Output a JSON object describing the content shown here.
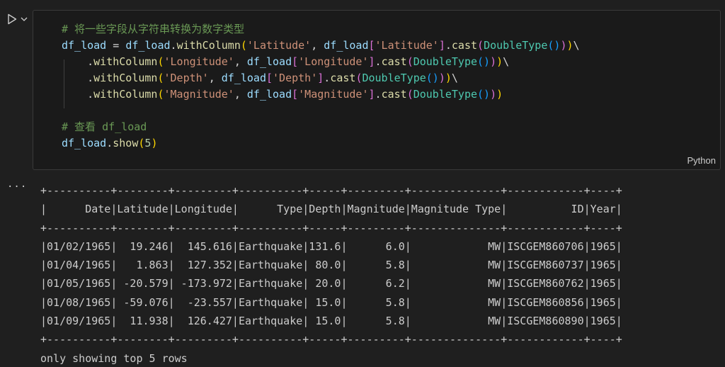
{
  "cell": {
    "language": "Python",
    "code_lines": [
      [
        {
          "t": "# 将一些字段从字符串转换为数字类型",
          "c": "c-comment"
        }
      ],
      [
        {
          "t": "df_load",
          "c": "c-var"
        },
        {
          "t": " = ",
          "c": "c-op"
        },
        {
          "t": "df_load",
          "c": "c-var"
        },
        {
          "t": ".",
          "c": "c-op"
        },
        {
          "t": "withColumn",
          "c": "c-fn"
        },
        {
          "t": "(",
          "c": "c-paren"
        },
        {
          "t": "'Latitude'",
          "c": "c-str"
        },
        {
          "t": ", ",
          "c": "c-op"
        },
        {
          "t": "df_load",
          "c": "c-var"
        },
        {
          "t": "[",
          "c": "c-paren2"
        },
        {
          "t": "'Latitude'",
          "c": "c-str"
        },
        {
          "t": "]",
          "c": "c-paren2"
        },
        {
          "t": ".",
          "c": "c-op"
        },
        {
          "t": "cast",
          "c": "c-fn"
        },
        {
          "t": "(",
          "c": "c-paren2"
        },
        {
          "t": "DoubleType",
          "c": "c-type"
        },
        {
          "t": "()",
          "c": "c-paren3"
        },
        {
          "t": ")",
          "c": "c-paren2"
        },
        {
          "t": ")",
          "c": "c-paren"
        },
        {
          "t": "\\",
          "c": "c-op"
        }
      ],
      [
        {
          "t": "    .",
          "c": "c-op"
        },
        {
          "t": "withColumn",
          "c": "c-fn"
        },
        {
          "t": "(",
          "c": "c-paren"
        },
        {
          "t": "'Longitude'",
          "c": "c-str"
        },
        {
          "t": ", ",
          "c": "c-op"
        },
        {
          "t": "df_load",
          "c": "c-var"
        },
        {
          "t": "[",
          "c": "c-paren2"
        },
        {
          "t": "'Longitude'",
          "c": "c-str"
        },
        {
          "t": "]",
          "c": "c-paren2"
        },
        {
          "t": ".",
          "c": "c-op"
        },
        {
          "t": "cast",
          "c": "c-fn"
        },
        {
          "t": "(",
          "c": "c-paren2"
        },
        {
          "t": "DoubleType",
          "c": "c-type"
        },
        {
          "t": "()",
          "c": "c-paren3"
        },
        {
          "t": ")",
          "c": "c-paren2"
        },
        {
          "t": ")",
          "c": "c-paren"
        },
        {
          "t": "\\",
          "c": "c-op"
        }
      ],
      [
        {
          "t": "    .",
          "c": "c-op"
        },
        {
          "t": "withColumn",
          "c": "c-fn"
        },
        {
          "t": "(",
          "c": "c-paren"
        },
        {
          "t": "'Depth'",
          "c": "c-str"
        },
        {
          "t": ", ",
          "c": "c-op"
        },
        {
          "t": "df_load",
          "c": "c-var"
        },
        {
          "t": "[",
          "c": "c-paren2"
        },
        {
          "t": "'Depth'",
          "c": "c-str"
        },
        {
          "t": "]",
          "c": "c-paren2"
        },
        {
          "t": ".",
          "c": "c-op"
        },
        {
          "t": "cast",
          "c": "c-fn"
        },
        {
          "t": "(",
          "c": "c-paren2"
        },
        {
          "t": "DoubleType",
          "c": "c-type"
        },
        {
          "t": "()",
          "c": "c-paren3"
        },
        {
          "t": ")",
          "c": "c-paren2"
        },
        {
          "t": ")",
          "c": "c-paren"
        },
        {
          "t": "\\",
          "c": "c-op"
        }
      ],
      [
        {
          "t": "    .",
          "c": "c-op"
        },
        {
          "t": "withColumn",
          "c": "c-fn"
        },
        {
          "t": "(",
          "c": "c-paren"
        },
        {
          "t": "'Magnitude'",
          "c": "c-str"
        },
        {
          "t": ", ",
          "c": "c-op"
        },
        {
          "t": "df_load",
          "c": "c-var"
        },
        {
          "t": "[",
          "c": "c-paren2"
        },
        {
          "t": "'Magnitude'",
          "c": "c-str"
        },
        {
          "t": "]",
          "c": "c-paren2"
        },
        {
          "t": ".",
          "c": "c-op"
        },
        {
          "t": "cast",
          "c": "c-fn"
        },
        {
          "t": "(",
          "c": "c-paren2"
        },
        {
          "t": "DoubleType",
          "c": "c-type"
        },
        {
          "t": "()",
          "c": "c-paren3"
        },
        {
          "t": ")",
          "c": "c-paren2"
        },
        {
          "t": ")",
          "c": "c-paren"
        }
      ],
      [],
      [
        {
          "t": "# 查看 df_load",
          "c": "c-comment"
        }
      ],
      [
        {
          "t": "df_load",
          "c": "c-var"
        },
        {
          "t": ".",
          "c": "c-op"
        },
        {
          "t": "show",
          "c": "c-fn"
        },
        {
          "t": "(",
          "c": "c-paren"
        },
        {
          "t": "5",
          "c": "c-num"
        },
        {
          "t": ")",
          "c": "c-paren"
        }
      ]
    ]
  },
  "output": {
    "menu_label": "...",
    "lines": [
      "+----------+--------+---------+----------+-----+---------+--------------+------------+----+",
      "|      Date|Latitude|Longitude|      Type|Depth|Magnitude|Magnitude Type|          ID|Year|",
      "+----------+--------+---------+----------+-----+---------+--------------+------------+----+",
      "|01/02/1965|  19.246|  145.616|Earthquake|131.6|      6.0|            MW|ISCGEM860706|1965|",
      "|01/04/1965|   1.863|  127.352|Earthquake| 80.0|      5.8|            MW|ISCGEM860737|1965|",
      "|01/05/1965| -20.579| -173.972|Earthquake| 20.0|      6.2|            MW|ISCGEM860762|1965|",
      "|01/08/1965| -59.076|  -23.557|Earthquake| 15.0|      5.8|            MW|ISCGEM860856|1965|",
      "|01/09/1965|  11.938|  126.427|Earthquake| 15.0|      5.8|            MW|ISCGEM860890|1965|",
      "+----------+--------+---------+----------+-----+---------+--------------+------------+----+",
      "only showing top 5 rows"
    ]
  },
  "icons": {
    "run": "run-icon",
    "chevron": "chevron-down-icon"
  }
}
